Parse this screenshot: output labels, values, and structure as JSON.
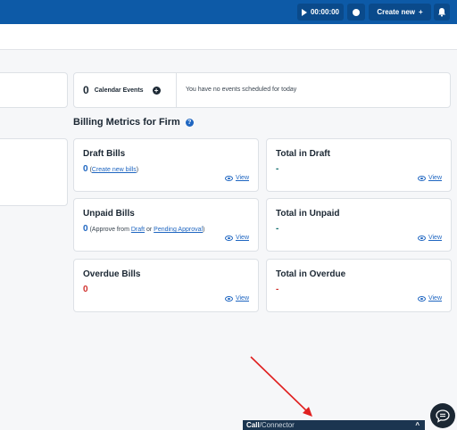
{
  "topbar": {
    "timer_label": "00:00:00",
    "create_label": "Create new",
    "create_plus": "+"
  },
  "calendar": {
    "count": "0",
    "label": "Calendar Events",
    "plus": "+",
    "message": "You have no events scheduled for today"
  },
  "billing": {
    "title": "Billing Metrics for Firm",
    "help": "?",
    "view_label": "View",
    "draft_bills": {
      "title": "Draft Bills",
      "value": "0",
      "note_prefix": "(",
      "note_link": "Create new bills",
      "note_suffix": ")"
    },
    "total_draft": {
      "title": "Total in Draft",
      "value": "-"
    },
    "unpaid_bills": {
      "title": "Unpaid Bills",
      "value": "0",
      "note_prefix": "(Approve from ",
      "note_link1": "Draft",
      "note_mid": " or ",
      "note_link2": "Pending Approval",
      "note_suffix": ")"
    },
    "total_unpaid": {
      "title": "Total in Unpaid",
      "value": "-"
    },
    "overdue_bills": {
      "title": "Overdue Bills",
      "value": "0"
    },
    "total_overdue": {
      "title": "Total in Overdue",
      "value": "-"
    }
  },
  "connector": {
    "label_bold": "Call",
    "label_rest": "/Connector",
    "chevron": "^"
  },
  "colors": {
    "topbar": "#0d5aa7",
    "accent": "#1f66c1",
    "overdue": "#d0312d",
    "arrow": "#e02020"
  },
  "icons": [
    "play-icon",
    "clock-icon",
    "plus-icon",
    "bell-icon",
    "help-icon",
    "eye-icon",
    "chevron-up-icon",
    "chat-icon",
    "arrow-annotation"
  ]
}
